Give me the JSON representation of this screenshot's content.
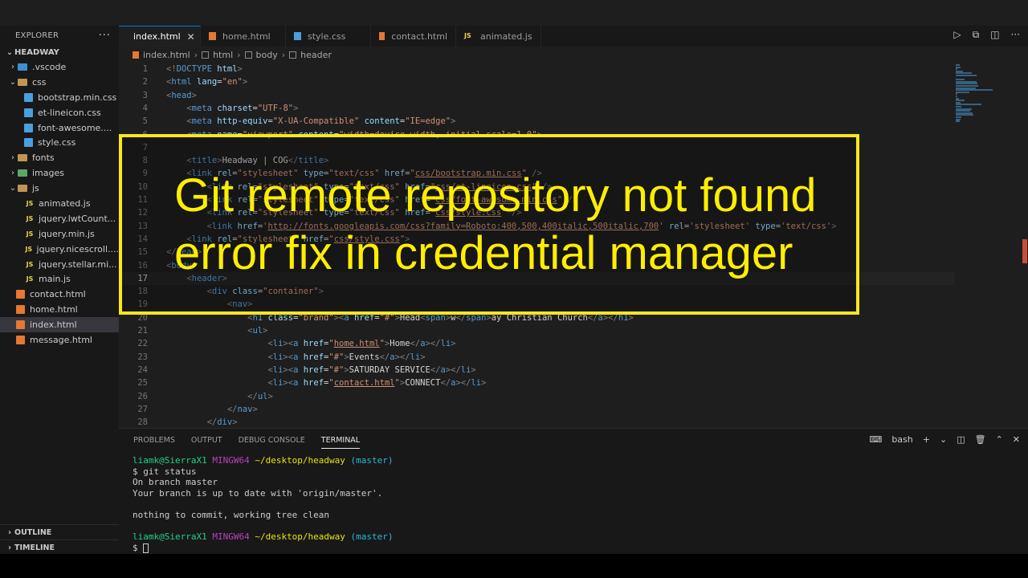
{
  "explorer": {
    "title": "EXPLORER",
    "more": "···",
    "workspace": "HEADWAY",
    "items": [
      {
        "label": ".vscode",
        "kind": "folder",
        "icon": "folder-vscode-icon"
      },
      {
        "label": "css",
        "kind": "folder-open",
        "icon": "folder-css-icon"
      },
      {
        "label": "bootstrap.min.css",
        "kind": "css",
        "icon": "css-file-icon"
      },
      {
        "label": "et-lineicon.css",
        "kind": "css",
        "icon": "css-file-icon"
      },
      {
        "label": "font-awesome....",
        "kind": "css",
        "icon": "css-file-icon"
      },
      {
        "label": "style.css",
        "kind": "css",
        "icon": "css-file-icon"
      },
      {
        "label": "fonts",
        "kind": "folder",
        "icon": "folder-icon"
      },
      {
        "label": "images",
        "kind": "folder",
        "icon": "folder-images-icon"
      },
      {
        "label": "js",
        "kind": "folder-open",
        "icon": "folder-js-icon"
      },
      {
        "label": "animated.js",
        "kind": "js",
        "icon": "js-file-icon"
      },
      {
        "label": "jquery.lwtCount...",
        "kind": "js",
        "icon": "js-file-icon"
      },
      {
        "label": "jquery.min.js",
        "kind": "js",
        "icon": "js-file-icon"
      },
      {
        "label": "jquery.nicescroll....",
        "kind": "js",
        "icon": "js-file-icon"
      },
      {
        "label": "jquery.stellar.mi...",
        "kind": "js",
        "icon": "js-file-icon"
      },
      {
        "label": "main.js",
        "kind": "js",
        "icon": "js-file-icon"
      },
      {
        "label": "contact.html",
        "kind": "html",
        "icon": "html-file-icon"
      },
      {
        "label": "home.html",
        "kind": "html",
        "icon": "html-file-icon"
      },
      {
        "label": "index.html",
        "kind": "html",
        "icon": "html-file-icon",
        "active": true
      },
      {
        "label": "message.html",
        "kind": "html",
        "icon": "html-file-icon"
      }
    ],
    "outline": "OUTLINE",
    "timeline": "TIMELINE"
  },
  "tabs": [
    {
      "label": "index.html",
      "type": "html",
      "active": true,
      "close": "✕"
    },
    {
      "label": "home.html",
      "type": "html"
    },
    {
      "label": "style.css",
      "type": "css"
    },
    {
      "label": "contact.html",
      "type": "html"
    },
    {
      "label": "animated.js",
      "type": "js",
      "js_badge": "JS"
    }
  ],
  "breadcrumb": [
    "index.html",
    "html",
    "body",
    "header"
  ],
  "code_lines": [
    {
      "n": "1",
      "html": "<span class='t'>&lt;!</span><span class='tn'>DOCTYPE</span> <span class='a'>html</span><span class='t'>&gt;</span>"
    },
    {
      "n": "2",
      "html": "<span class='t'>&lt;</span><span class='tn'>html</span> <span class='a'>lang</span><span class='x'>=</span><span class='s'>\"en\"</span><span class='t'>&gt;</span>"
    },
    {
      "n": "3",
      "html": "<span class='t'>&lt;</span><span class='tn'>head</span><span class='t'>&gt;</span>"
    },
    {
      "n": "4",
      "html": "    <span class='t'>&lt;</span><span class='tn'>meta</span> <span class='a'>charset</span><span class='x'>=</span><span class='s'>\"UTF-8\"</span><span class='t'>&gt;</span>"
    },
    {
      "n": "5",
      "html": "    <span class='t'>&lt;</span><span class='tn'>meta</span> <span class='a'>http-equiv</span><span class='x'>=</span><span class='s'>\"X-UA-Compatible\"</span> <span class='a'>content</span><span class='x'>=</span><span class='s'>\"IE=edge\"</span><span class='t'>&gt;</span>"
    },
    {
      "n": "6",
      "html": "    <span class='t'>&lt;</span><span class='tn'>meta</span> <span class='a'>name</span><span class='x'>=</span><span class='s'>\"viewport\"</span> <span class='a'>content</span><span class='x'>=</span><span class='s'>\"width=device-width, initial-scale=1.0\"</span><span class='t'>&gt;</span>"
    },
    {
      "n": "7",
      "html": ""
    },
    {
      "n": "8",
      "html": "    <span class='t'>&lt;</span><span class='tn'>title</span><span class='t'>&gt;</span><span class='x'>Headway | COG</span><span class='t'>&lt;/</span><span class='tn'>title</span><span class='t'>&gt;</span>"
    },
    {
      "n": "9",
      "html": "    <span class='t'>&lt;</span><span class='tn'>link</span> <span class='a'>rel</span><span class='x'>=</span><span class='s'>\"stylesheet\"</span> <span class='a'>type</span><span class='x'>=</span><span class='s'>\"text/css\"</span> <span class='a'>href</span><span class='x'>=</span><span class='s'>\"</span><span class='u'>css/bootstrap.min.css</span><span class='s'>\"</span> <span class='t'>/&gt;</span>"
    },
    {
      "n": "10",
      "html": "        <span class='t'>&lt;</span><span class='tn'>link</span> <span class='a'>rel</span><span class='x'>=</span><span class='s'>\"stylesheet\"</span> <span class='a'>type</span><span class='x'>=</span><span class='s'>\"text/css\"</span> <span class='a'>href</span><span class='x'>=</span><span class='s'>\"</span><span class='u'>css/et-lineicon.css</span><span class='s'>\"</span> <span class='t'>/&gt;</span>"
    },
    {
      "n": "11",
      "html": "        <span class='t'>&lt;</span><span class='tn'>link</span> <span class='a'>rel</span><span class='x'>=</span><span class='s'>\"stylesheet\"</span> <span class='a'>type</span><span class='x'>=</span><span class='s'>\"text/css\"</span> <span class='a'>href</span><span class='x'>=</span><span class='s'>\"</span><span class='u'>css/font-awesome.min.css</span><span class='s'>\"</span> <span class='t'>/&gt;</span>"
    },
    {
      "n": "12",
      "html": "        <span class='t'>&lt;</span><span class='tn'>link</span> <span class='a'>rel</span><span class='x'>=</span><span class='s'>\"stylesheet\"</span> <span class='a'>type</span><span class='x'>=</span><span class='s'>\"text/css\"</span> <span class='a'>href</span><span class='x'>=</span><span class='s'>\"</span><span class='u'>css/style.css</span><span class='s'>\"</span> <span class='t'>/&gt;</span>"
    },
    {
      "n": "13",
      "html": "        <span class='t'>&lt;</span><span class='tn'>link</span> <span class='a'>href</span><span class='x'>=</span><span class='s'>'</span><span class='u'>http://fonts.googleapis.com/css?family=Roboto:400,500,400italic,500italic,700</span><span class='s'>'</span> <span class='a'>rel</span><span class='x'>=</span><span class='s'>'stylesheet'</span> <span class='a'>type</span><span class='x'>=</span><span class='s'>'text/css'</span><span class='t'>&gt;</span>"
    },
    {
      "n": "14",
      "html": "    <span class='t'>&lt;</span><span class='tn'>link</span> <span class='a'>rel</span><span class='x'>=</span><span class='s'>\"stylesheet\"</span> <span class='a'>href</span><span class='x'>=</span><span class='s'>\"</span><span class='u'>css/style.css</span><span class='s'>\"</span><span class='t'>&gt;</span>"
    },
    {
      "n": "15",
      "html": "<span class='t'>&lt;/</span><span class='tn'>head</span><span class='t'>&gt;</span>"
    },
    {
      "n": "16",
      "html": "<span class='t'>&lt;</span><span class='tn'>body</span><span class='t'>&gt;</span>"
    },
    {
      "n": "17",
      "html": "    <span class='t'>&lt;</span><span class='tn'>header</span><span class='t'>&gt;</span>",
      "current": true
    },
    {
      "n": "18",
      "html": "        <span class='t'>&lt;</span><span class='tn'>div</span> <span class='a'>class</span><span class='x'>=</span><span class='s'>\"container\"</span><span class='t'>&gt;</span>"
    },
    {
      "n": "19",
      "html": "            <span class='t'>&lt;</span><span class='tn'>nav</span><span class='t'>&gt;</span>"
    },
    {
      "n": "20",
      "html": "                <span class='t'>&lt;</span><span class='tn'>h1</span> <span class='a'>class</span><span class='x'>=</span><span class='s'>\"brand\"</span><span class='t'>&gt;&lt;</span><span class='tn'>a</span> <span class='a'>href</span><span class='x'>=</span><span class='s'>\"#\"</span><span class='t'>&gt;</span><span class='x'>Head</span><span class='t'>&lt;</span><span class='tn'>span</span><span class='t'>&gt;</span><span class='x'>w</span><span class='t'>&lt;/</span><span class='tn'>span</span><span class='t'>&gt;</span><span class='x'>ay Christian Church</span><span class='t'>&lt;/</span><span class='tn'>a</span><span class='t'>&gt;&lt;/</span><span class='tn'>h1</span><span class='t'>&gt;</span>"
    },
    {
      "n": "21",
      "html": "                <span class='t'>&lt;</span><span class='tn'>ul</span><span class='t'>&gt;</span>"
    },
    {
      "n": "22",
      "html": "                    <span class='t'>&lt;</span><span class='tn'>li</span><span class='t'>&gt;&lt;</span><span class='tn'>a</span> <span class='a'>href</span><span class='x'>=</span><span class='s'>\"</span><span class='u'>home.html</span><span class='s'>\"</span><span class='t'>&gt;</span><span class='x'>Home</span><span class='t'>&lt;/</span><span class='tn'>a</span><span class='t'>&gt;&lt;/</span><span class='tn'>li</span><span class='t'>&gt;</span>"
    },
    {
      "n": "23",
      "html": "                    <span class='t'>&lt;</span><span class='tn'>li</span><span class='t'>&gt;&lt;</span><span class='tn'>a</span> <span class='a'>href</span><span class='x'>=</span><span class='s'>\"#\"</span><span class='t'>&gt;</span><span class='x'>Events</span><span class='t'>&lt;/</span><span class='tn'>a</span><span class='t'>&gt;&lt;/</span><span class='tn'>li</span><span class='t'>&gt;</span>"
    },
    {
      "n": "24",
      "html": "                    <span class='t'>&lt;</span><span class='tn'>li</span><span class='t'>&gt;&lt;</span><span class='tn'>a</span> <span class='a'>href</span><span class='x'>=</span><span class='s'>\"#\"</span><span class='t'>&gt;</span><span class='x'>SATURDAY SERVICE</span><span class='t'>&lt;/</span><span class='tn'>a</span><span class='t'>&gt;&lt;/</span><span class='tn'>li</span><span class='t'>&gt;</span>"
    },
    {
      "n": "25",
      "html": "                    <span class='t'>&lt;</span><span class='tn'>li</span><span class='t'>&gt;&lt;</span><span class='tn'>a</span> <span class='a'>href</span><span class='x'>=</span><span class='s'>\"</span><span class='u'>contact.html</span><span class='s'>\"</span><span class='t'>&gt;</span><span class='x'>CONNECT</span><span class='t'>&lt;/</span><span class='tn'>a</span><span class='t'>&gt;&lt;/</span><span class='tn'>li</span><span class='t'>&gt;</span>"
    },
    {
      "n": "26",
      "html": "                <span class='t'>&lt;/</span><span class='tn'>ul</span><span class='t'>&gt;</span>"
    },
    {
      "n": "27",
      "html": "            <span class='t'>&lt;/</span><span class='tn'>nav</span><span class='t'>&gt;</span>"
    },
    {
      "n": "28",
      "html": "        <span class='t'>&lt;/</span><span class='tn'>div</span><span class='t'>&gt;</span>"
    }
  ],
  "overlay": {
    "line1": "Git remote repository not found",
    "line2": "error fix in credential manager"
  },
  "panel": {
    "tabs": [
      "PROBLEMS",
      "OUTPUT",
      "DEBUG CONSOLE",
      "TERMINAL"
    ],
    "active_tab": "TERMINAL",
    "shell": "bash",
    "terminal": {
      "user": "liamk@SierraX1",
      "env": "MINGW64",
      "path": "~/desktop/headway",
      "branch": "(master)",
      "command": "$ git status",
      "output": [
        "On branch master",
        "Your branch is up to date with 'origin/master'.",
        "",
        "nothing to commit, working tree clean"
      ],
      "prompt": "$"
    }
  },
  "colors": {
    "overlay_border": "#f8e71c",
    "overlay_text": "#ffee00",
    "accent": "#0078d4"
  }
}
